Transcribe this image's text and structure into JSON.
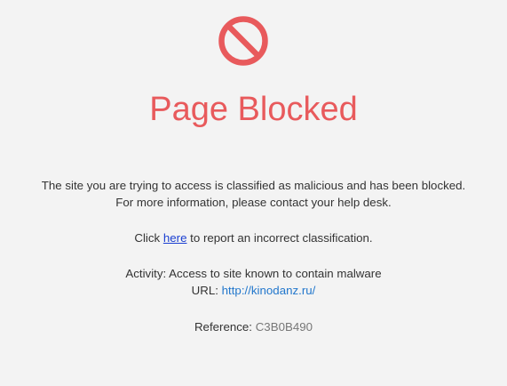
{
  "colors": {
    "accent": "#e85a5c",
    "background": "#f3f3f3",
    "text": "#333333",
    "link_report": "#1a3fd1",
    "link_url": "#2277cc",
    "reference": "#777777"
  },
  "icon": "prohibited-icon",
  "title": "Page Blocked",
  "message_line1": "The site you are trying to access is classified as malicious and has been blocked.",
  "message_line2": "For more information, please contact your help desk.",
  "report": {
    "prefix": "Click ",
    "link_text": "here",
    "suffix": " to report an incorrect classification."
  },
  "activity": {
    "label": "Activity: ",
    "value": "Access to site known to contain malware"
  },
  "url": {
    "label": "URL: ",
    "value": "http://kinodanz.ru/"
  },
  "reference": {
    "label": "Reference: ",
    "value": "C3B0B490"
  }
}
